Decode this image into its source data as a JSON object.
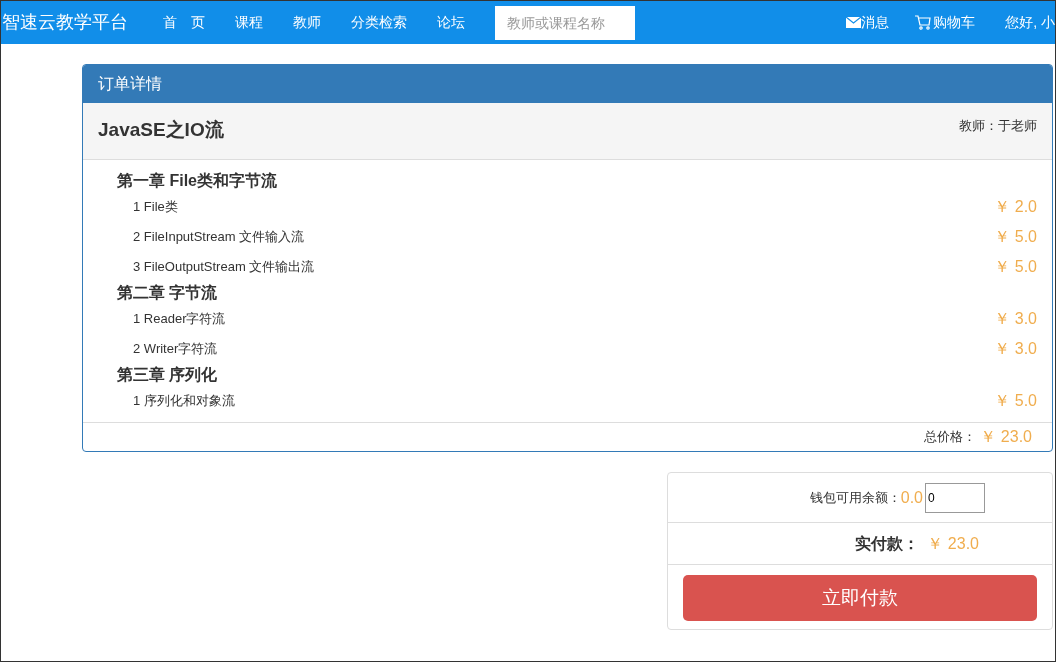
{
  "nav": {
    "brand": "智速云教学平台",
    "links": [
      "首　页",
      "课程",
      "教师",
      "分类检索",
      "论坛"
    ],
    "search": {
      "placeholder": "教师或课程名称"
    },
    "messages": "消息",
    "cart": "购物车",
    "greeting": "您好, 小"
  },
  "order": {
    "title": "订单详情",
    "course": "JavaSE之IO流",
    "teacher": "教师：于老师",
    "chapters": [
      {
        "title": "第一章 File类和字节流",
        "lessons": [
          {
            "name": "1 File类",
            "price": "￥ 2.0"
          },
          {
            "name": "2 FileInputStream 文件输入流",
            "price": "￥ 5.0"
          },
          {
            "name": "3 FileOutputStream 文件输出流",
            "price": "￥ 5.0"
          }
        ]
      },
      {
        "title": "第二章 字节流",
        "lessons": [
          {
            "name": "1 Reader字符流",
            "price": "￥ 3.0"
          },
          {
            "name": "2 Writer字符流",
            "price": "￥ 3.0"
          }
        ]
      },
      {
        "title": "第三章 序列化",
        "lessons": [
          {
            "name": "1 序列化和对象流",
            "price": "￥ 5.0"
          }
        ]
      }
    ],
    "total_label": "总价格：",
    "total": "￥ 23.0"
  },
  "payment": {
    "wallet_label": "钱包可用余额：",
    "wallet_balance": "0.0",
    "wallet_input": "0",
    "due_label": "实付款：",
    "due": "￥ 23.0",
    "pay_button": "立即付款"
  }
}
